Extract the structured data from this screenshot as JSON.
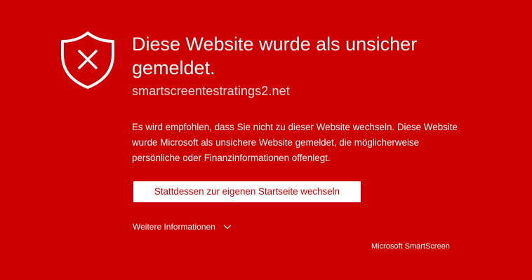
{
  "warning": {
    "title": "Diese Website wurde als unsicher gemeldet.",
    "site_url": "smartscreentestratings2.net",
    "description": "Es wird empfohlen, dass Sie nicht zu dieser Website wechseln. Diese Website wurde Microsoft als unsichere Website gemeldet, die möglicherweise persönliche oder Finanzinformationen offenlegt.",
    "home_button_label": "Stattdessen zur eigenen Startseite wechseln",
    "more_info_label": "Weitere Informationen",
    "brand": "Microsoft SmartScreen"
  },
  "icons": {
    "shield": "shield-x-icon",
    "expand": "chevron-down-icon"
  },
  "colors": {
    "background": "#cd0000",
    "foreground": "#ffffff",
    "url": "#ffdede",
    "button_background": "#ffffff",
    "button_text": "#cd0000"
  }
}
